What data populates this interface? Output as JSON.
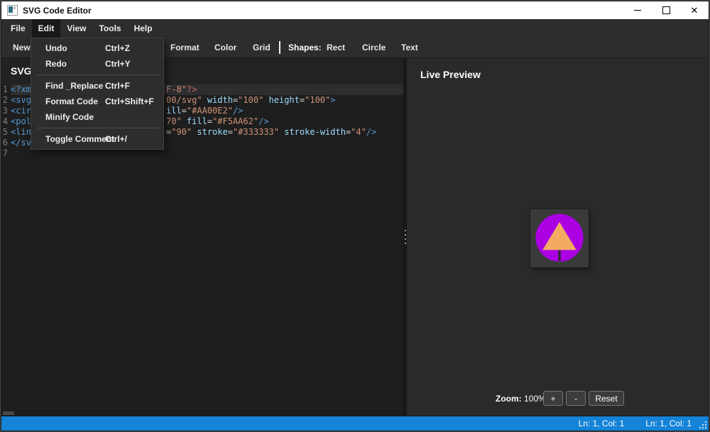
{
  "window": {
    "title": "SVG Code Editor",
    "controls": {
      "minimize": "minimize",
      "maximize": "maximize",
      "close": "✕"
    }
  },
  "menubar": {
    "items": [
      "File",
      "Edit",
      "View",
      "Tools",
      "Help"
    ],
    "active_index": 1
  },
  "edit_menu": {
    "items": [
      {
        "label": "Undo",
        "shortcut": "Ctrl+Z"
      },
      {
        "label": "Redo",
        "shortcut": "Ctrl+Y"
      },
      {
        "type": "separator"
      },
      {
        "label": "Find _Replace",
        "shortcut": "Ctrl+F"
      },
      {
        "label": "Format Code",
        "shortcut": "Ctrl+Shift+F"
      },
      {
        "label": "Minify Code",
        "shortcut": ""
      },
      {
        "type": "separator"
      },
      {
        "label": "Toggle Comment",
        "shortcut": "Ctrl+/"
      }
    ]
  },
  "toolbar": {
    "items": [
      "New",
      "Format",
      "Color",
      "Grid",
      "Shapes:",
      "Rect",
      "Circle",
      "Text"
    ]
  },
  "editor": {
    "panel_title": "SVG",
    "lines": [
      {
        "n": "1",
        "current": true,
        "left": [
          {
            "t": "<?xm",
            "c": "tag"
          }
        ],
        "right": [
          {
            "t": "F-8\"",
            "c": "str"
          },
          {
            "t": "?>",
            "c": "decl"
          }
        ]
      },
      {
        "n": "2",
        "left": [
          {
            "t": "<svg",
            "c": "tag"
          }
        ],
        "right": [
          {
            "t": "00/svg\"",
            "c": "str"
          },
          {
            "t": " ",
            "c": "pln"
          },
          {
            "t": "width",
            "c": "attr"
          },
          {
            "t": "=",
            "c": "pln"
          },
          {
            "t": "\"100\"",
            "c": "str"
          },
          {
            "t": " ",
            "c": "pln"
          },
          {
            "t": "height",
            "c": "attr"
          },
          {
            "t": "=",
            "c": "pln"
          },
          {
            "t": "\"100\"",
            "c": "str"
          },
          {
            "t": ">",
            "c": "tag"
          }
        ]
      },
      {
        "n": "3",
        "left": [
          {
            "t": "<cir",
            "c": "tag"
          }
        ],
        "right": [
          {
            "t": "ill",
            "c": "attr"
          },
          {
            "t": "=",
            "c": "pln"
          },
          {
            "t": "\"#AA00E2\"",
            "c": "str"
          },
          {
            "t": "/>",
            "c": "tag"
          }
        ]
      },
      {
        "n": "4",
        "left": [
          {
            "t": "<pol",
            "c": "tag"
          }
        ],
        "right": [
          {
            "t": "70\"",
            "c": "str"
          },
          {
            "t": " ",
            "c": "pln"
          },
          {
            "t": "fill",
            "c": "attr"
          },
          {
            "t": "=",
            "c": "pln"
          },
          {
            "t": "\"#F5AA62\"",
            "c": "str"
          },
          {
            "t": "/>",
            "c": "tag"
          }
        ]
      },
      {
        "n": "5",
        "left": [
          {
            "t": "<lin",
            "c": "tag"
          }
        ],
        "right": [
          {
            "t": "=",
            "c": "pln"
          },
          {
            "t": "\"90\"",
            "c": "str"
          },
          {
            "t": " ",
            "c": "pln"
          },
          {
            "t": "stroke",
            "c": "attr"
          },
          {
            "t": "=",
            "c": "pln"
          },
          {
            "t": "\"#333333\"",
            "c": "str"
          },
          {
            "t": " ",
            "c": "pln"
          },
          {
            "t": "stroke-width",
            "c": "attr"
          },
          {
            "t": "=",
            "c": "pln"
          },
          {
            "t": "\"4\"",
            "c": "str"
          },
          {
            "t": "/>",
            "c": "tag"
          }
        ]
      },
      {
        "n": "6",
        "left": [
          {
            "t": "</sv",
            "c": "tag"
          }
        ],
        "right": []
      },
      {
        "n": "7",
        "left": [],
        "right": []
      }
    ]
  },
  "preview": {
    "title": "Live Preview",
    "canvas": {
      "circle_fill": "#AA00E2",
      "triangle_fill": "#F5AA62",
      "trunk_stroke": "#2b2b2b"
    },
    "zoom": {
      "label": "Zoom:",
      "value": "100%",
      "plus": "+",
      "minus": "-",
      "reset": "Reset"
    }
  },
  "statusbar": {
    "items": [
      "Ln: 1, Col: 1",
      "Ln: 1, Col: 1"
    ],
    "color": "#1583d8"
  },
  "colors": {
    "code_tag": "#569cd6",
    "code_attr": "#9cdcfe",
    "code_string": "#ce9178",
    "shape_circle": "#AA00E2",
    "shape_triangle": "#F5AA62",
    "shape_trunk": "#333333"
  }
}
